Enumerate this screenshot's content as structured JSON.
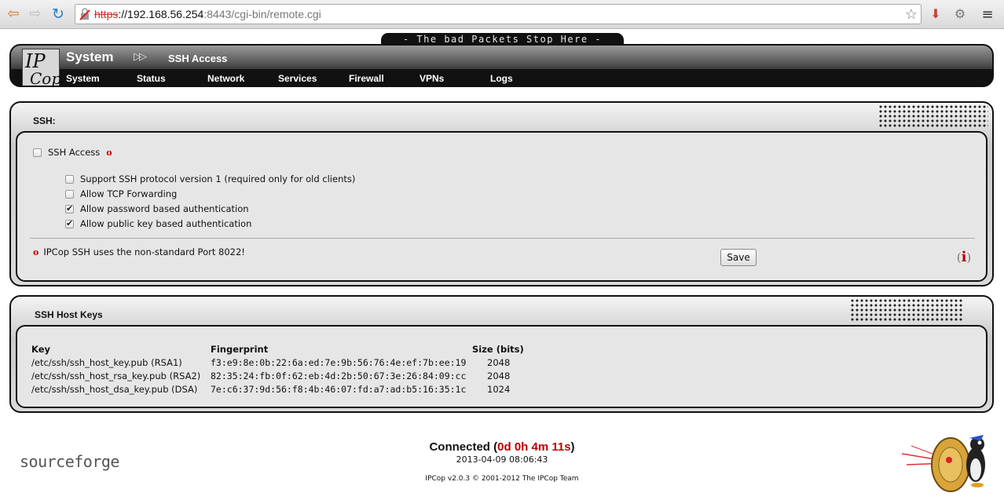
{
  "browser": {
    "url_scheme": "https",
    "url_host": "://192.168.56.254",
    "url_path": ":8443/cgi-bin/remote.cgi",
    "icons": [
      "back-arrow-icon",
      "forward-arrow-icon",
      "reload-icon",
      "insecure-lock-icon",
      "bookmark-star-icon",
      "download-icon",
      "settings-gear-icon",
      "menu-icon"
    ]
  },
  "banner": {
    "text": "- The bad Packets Stop Here -"
  },
  "header": {
    "section": "System",
    "page": "SSH Access",
    "menu": [
      "System",
      "Status",
      "Network",
      "Services",
      "Firewall",
      "VPNs",
      "Logs"
    ]
  },
  "ssh_panel": {
    "title": "SSH:",
    "ssh_access": {
      "label": "SSH Access",
      "checked": false,
      "marker": "o"
    },
    "options": [
      {
        "label": "Support SSH protocol version 1 (required only for old clients)",
        "checked": false
      },
      {
        "label": "Allow TCP Forwarding",
        "checked": false
      },
      {
        "label": "Allow password based authentication",
        "checked": true
      },
      {
        "label": "Allow public key based authentication",
        "checked": true
      }
    ],
    "note_marker": "o",
    "note": "IPCop SSH uses the non-standard Port 8022!",
    "save_label": "Save",
    "info_label": "i"
  },
  "hostkeys_panel": {
    "title": "SSH Host Keys",
    "columns": {
      "key": "Key",
      "fingerprint": "Fingerprint",
      "size": "Size (bits)"
    },
    "rows": [
      {
        "key": "/etc/ssh/ssh_host_key.pub (RSA1)",
        "fingerprint": "f3:e9:8e:0b:22:6a:ed:7e:9b:56:76:4e:ef:7b:ee:19",
        "size": "2048"
      },
      {
        "key": "/etc/ssh/ssh_host_rsa_key.pub (RSA2)",
        "fingerprint": "82:35:24:fb:0f:62:eb:4d:2b:50:67:3e:26:84:09:cc",
        "size": "2048"
      },
      {
        "key": "/etc/ssh/ssh_host_dsa_key.pub (DSA)",
        "fingerprint": "7e:c6:37:9d:56:f8:4b:46:07:fd:a7:ad:b5:16:35:1c",
        "size": "1024"
      }
    ]
  },
  "footer": {
    "sourceforge": "sourceforge",
    "connected_label": "Connected",
    "uptime": "0d 0h 4m 11s",
    "timestamp": "2013-04-09 08:06:43",
    "copyright": "IPCop v2.0.3 © 2001-2012 The IPCop Team"
  },
  "colors": {
    "accent_red": "#bb0000",
    "header_black": "#111111",
    "panel_grey": "#d9d9d9"
  }
}
